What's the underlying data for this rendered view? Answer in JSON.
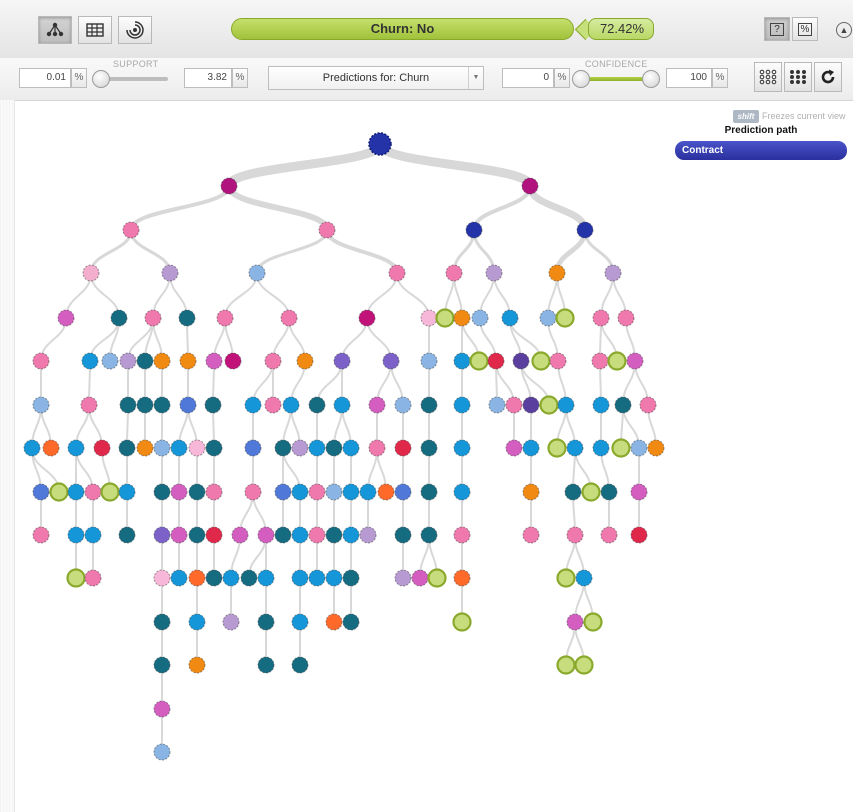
{
  "toolbar": {
    "view_buttons": [
      {
        "name": "tree-view-button",
        "active": true
      },
      {
        "name": "grid-view-button",
        "active": false
      },
      {
        "name": "sunburst-view-button",
        "active": false
      }
    ],
    "prediction_label": "Churn: No",
    "confidence_label": "72.42%",
    "option_buttons": [
      "?",
      "%"
    ]
  },
  "filters": {
    "support": {
      "label": "SUPPORT",
      "min_value": "0.01",
      "max_value": "3.82",
      "unit": "%"
    },
    "predictions_select": "Predictions for: Churn",
    "confidence": {
      "label": "CONFIDENCE",
      "min_value": "0",
      "max_value": "100",
      "unit": "%"
    }
  },
  "hint": {
    "key": "shift",
    "text": "Freezes current view"
  },
  "prediction_path": {
    "title": "Prediction path",
    "items": [
      "Contract"
    ]
  },
  "colors": {
    "edge": "#d8d8d8",
    "green_fill": "#c7dd7d",
    "green_stroke": "#8aa92c"
  }
}
